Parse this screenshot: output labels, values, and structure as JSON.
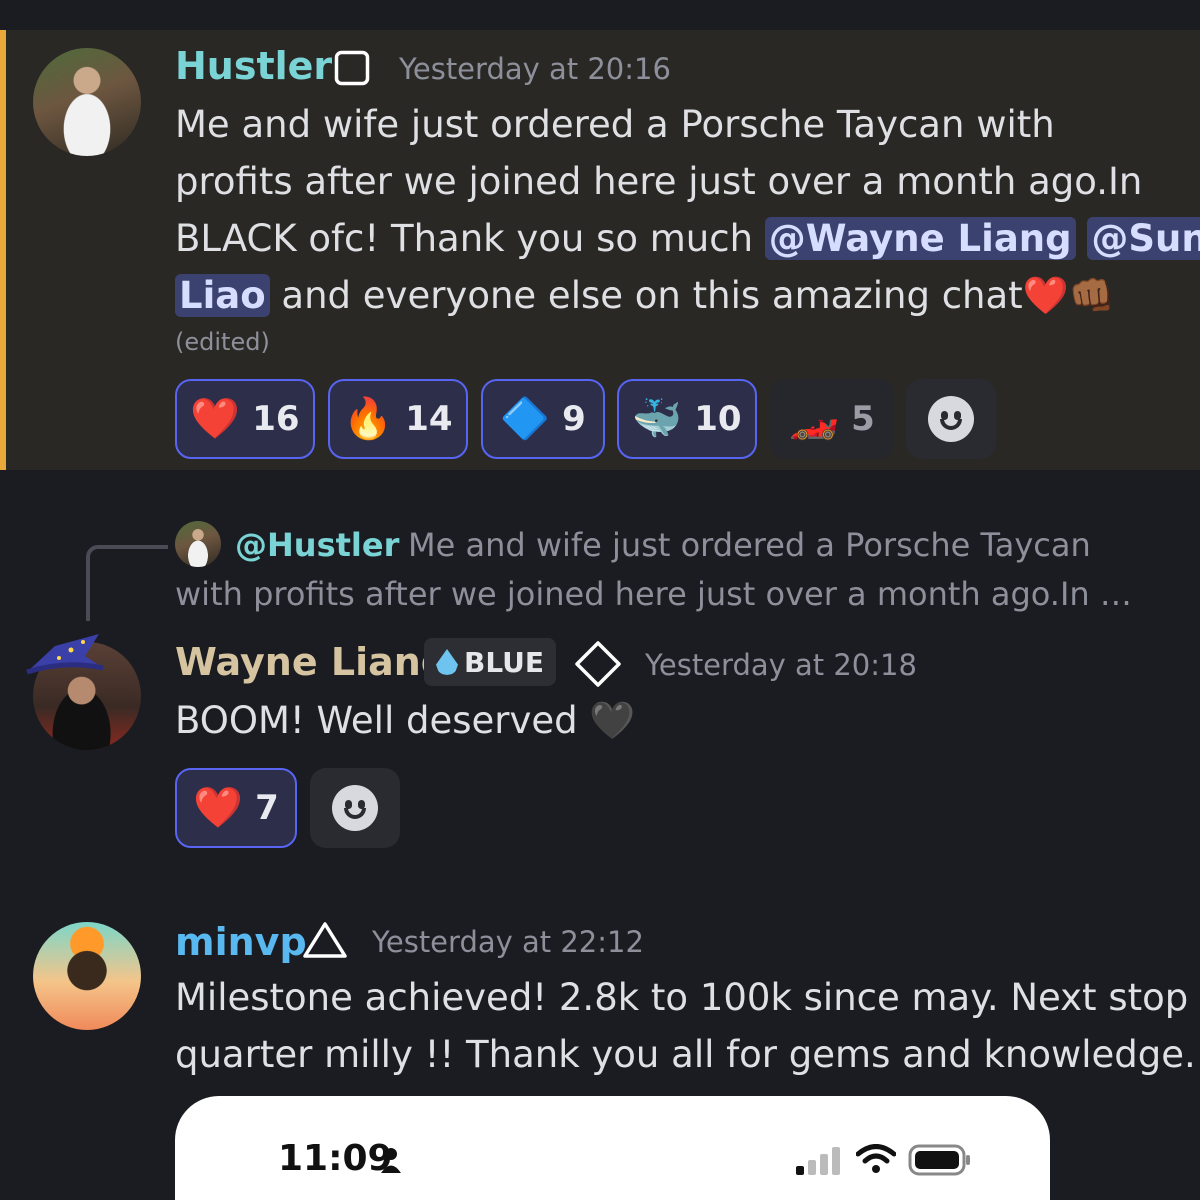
{
  "messages": [
    {
      "username": "Hustler",
      "timestamp": "Yesterday at 20:16",
      "lines": [
        "Me and wife just ordered a Porsche Taycan with",
        "profits after we joined here just over a month ago.In"
      ],
      "line3_pre": "BLACK ofc! Thank you so much ",
      "mention1": "@Wayne Liang",
      "mention2a": "@Sun",
      "mention2b": "Liao",
      "line4_post": " and everyone else on this amazing chat❤️👊🏾",
      "edited": "(edited)",
      "reactions": [
        {
          "emoji": "❤️",
          "count": "16"
        },
        {
          "emoji": "🔥",
          "count": "14"
        },
        {
          "emoji": "🔷",
          "count": "9"
        },
        {
          "emoji": "🐳",
          "count": "10"
        },
        {
          "emoji": "🏎️",
          "count": "5"
        }
      ]
    },
    {
      "reply_to": "@Hustler",
      "reply_text_1": "Me and wife just ordered a Porsche Taycan",
      "reply_text_2": "with profits after we joined here just over a month ago.In …",
      "username": "Wayne Liang",
      "badge": "BLUE",
      "timestamp": "Yesterday at 20:18",
      "text": "BOOM! Well deserved 🖤",
      "reactions": [
        {
          "emoji": "❤️",
          "count": "7"
        }
      ]
    },
    {
      "username": "minvp",
      "timestamp": "Yesterday at 22:12",
      "lines": [
        "Milestone achieved! 2.8k to 100k since may. Next stop",
        "quarter milly !! Thank you all for gems and knowledge."
      ]
    }
  ],
  "embed": {
    "time": "11:09"
  },
  "colors": {
    "hustler": "#7ad4d6",
    "wayne": "#d6c4a0",
    "minvp": "#5ab8f0",
    "highlight_bar": "#e8a93a",
    "mention_bg": "#3c4270",
    "reaction_border": "#5865f2"
  },
  "icons": {
    "hustler_role": "square-outline-icon",
    "wayne_role": "diamond-outline-icon",
    "minvp_role": "triangle-outline-icon",
    "add_reaction": "smiley-add-icon"
  }
}
